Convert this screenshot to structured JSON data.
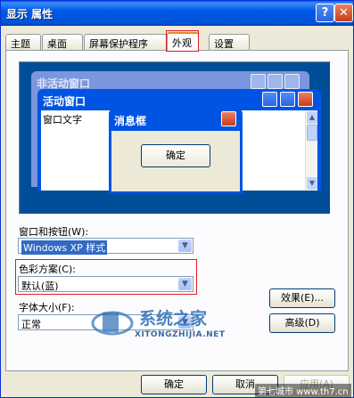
{
  "window": {
    "title": "显示 属性",
    "help_label": "?",
    "close_label": "✕"
  },
  "tabs": [
    {
      "label": "主题"
    },
    {
      "label": "桌面"
    },
    {
      "label": "屏幕保护程序"
    },
    {
      "label": "外观",
      "active": true
    },
    {
      "label": "设置"
    }
  ],
  "preview": {
    "inactive_title": "非活动窗口",
    "active_title": "活动窗口",
    "window_text": "窗口文字",
    "message_title": "消息框",
    "message_ok": "确定"
  },
  "windows_buttons": {
    "label": "窗口和按钮(W):",
    "value": "Windows XP 样式"
  },
  "color_scheme": {
    "label": "色彩方案(C):",
    "value": "默认(蓝)"
  },
  "font_size": {
    "label": "字体大小(F):",
    "value": "正常"
  },
  "side_buttons": {
    "effects": "效果(E)...",
    "advanced": "高级(D)"
  },
  "bottom_buttons": {
    "ok": "确定",
    "cancel": "取消",
    "apply": "应用(A)"
  },
  "watermark": {
    "brand": "系统之家",
    "domain": "XITONGZHIJIA.NET",
    "site": "第七城市 www.th7.cn"
  },
  "colors": {
    "accent_red": "#e31b23",
    "xp_blue": "#0054e3",
    "desktop_blue": "#004e98"
  },
  "icons": {
    "dropdown": "chevron-down-icon",
    "minimize": "minimize-icon",
    "maximize": "maximize-icon",
    "close": "close-icon"
  }
}
